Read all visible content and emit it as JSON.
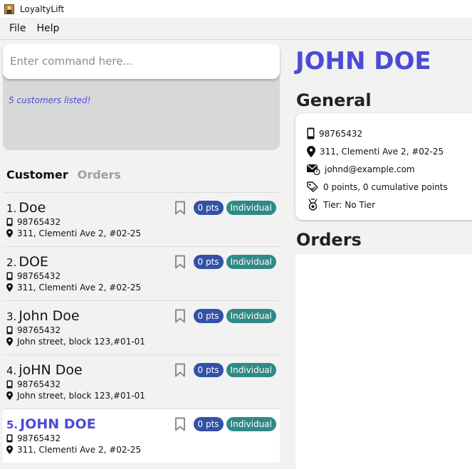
{
  "window": {
    "title": "LoyaltyLift"
  },
  "menu": [
    "File",
    "Help"
  ],
  "command": {
    "placeholder": "Enter command here...",
    "value": ""
  },
  "result": {
    "text": "5 customers listed!"
  },
  "tabs": {
    "customer": "Customer",
    "orders": "Orders"
  },
  "customers": [
    {
      "index": "1.",
      "name": "Doe",
      "phone": "98765432",
      "address": "311, Clementi Ave 2, #02-25",
      "points": "0 pts",
      "type": "Individual"
    },
    {
      "index": "2.",
      "name": "DOE",
      "phone": "98765432",
      "address": "311, Clementi Ave 2, #02-25",
      "points": "0 pts",
      "type": "Individual"
    },
    {
      "index": "3.",
      "name": "John Doe",
      "phone": "98765432",
      "address": "John street, block 123,#01-01",
      "points": "0 pts",
      "type": "Individual"
    },
    {
      "index": "4.",
      "name": "joHN Doe",
      "phone": "98765432",
      "address": "John street, block 123,#01-01",
      "points": "0 pts",
      "type": "Individual"
    },
    {
      "index": "5.",
      "name": "JOHN DOE",
      "phone": "98765432",
      "address": "311, Clementi Ave 2, #02-25",
      "points": "0 pts",
      "type": "Individual"
    }
  ],
  "detail": {
    "name": "JOHN DOE",
    "general_title": "General",
    "phone": "98765432",
    "address": "311, Clementi Ave 2, #02-25",
    "email": "johnd@example.com",
    "points": "0 points, 0 cumulative points",
    "tier": "Tier: No Tier",
    "orders_title": "Orders"
  },
  "colors": {
    "accent": "#4b4bd6",
    "points_pill": "#3251a8",
    "type_pill": "#2f8a86",
    "inactive_tab": "#a59c92"
  }
}
